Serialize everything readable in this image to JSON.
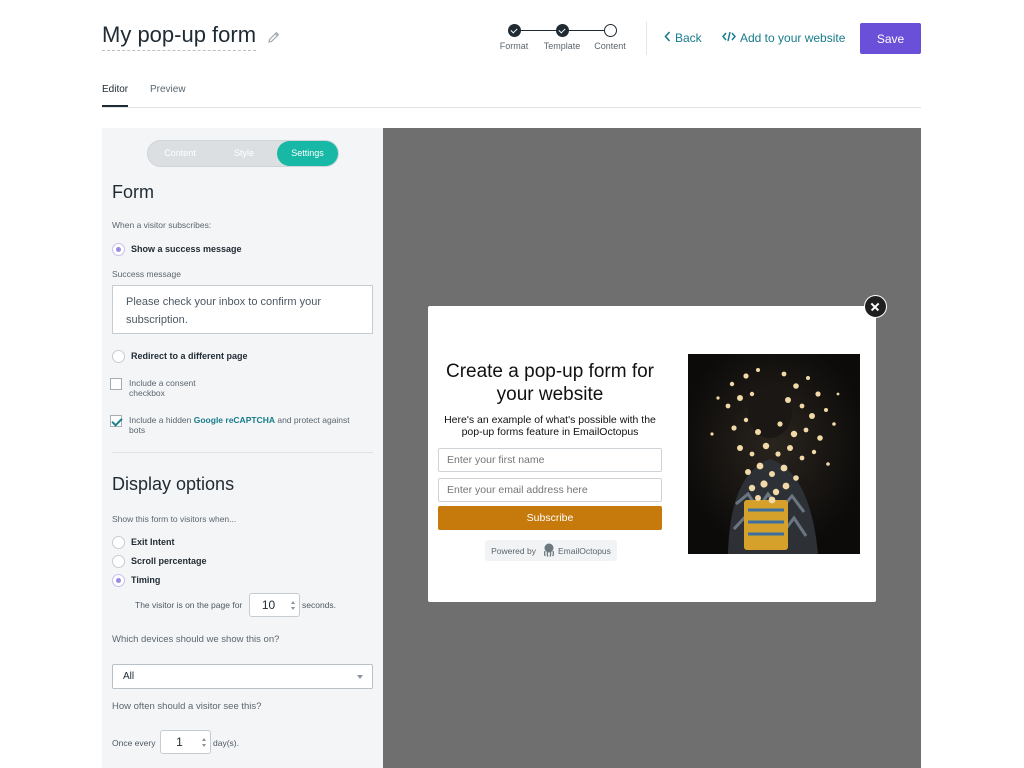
{
  "header": {
    "title": "My pop-up form",
    "steps": [
      {
        "label": "Format",
        "state": "done"
      },
      {
        "label": "Template",
        "state": "done"
      },
      {
        "label": "Content",
        "state": "current"
      }
    ],
    "back_label": "Back",
    "embed_label": "Add to your website",
    "save_label": "Save",
    "accent_color": "#6a50d8",
    "link_color": "#177c8c"
  },
  "tabs": [
    {
      "label": "Editor",
      "active": true
    },
    {
      "label": "Preview",
      "active": false
    }
  ],
  "sidebar": {
    "segments": [
      {
        "label": "Content",
        "active": false
      },
      {
        "label": "Style",
        "active": false
      },
      {
        "label": "Settings",
        "active": true
      }
    ],
    "form_heading": "Form",
    "subscribe_label": "When a visitor subscribes:",
    "show_success_label": "Show a success message",
    "success_message_label": "Success message",
    "success_message_value": "Please check your inbox to confirm your subscription.",
    "redirect_label": "Redirect to a different page",
    "consent_label": "Include a consent checkbox",
    "recaptcha_pre": "Include a hidden ",
    "recaptcha_link": "Google reCAPTCHA",
    "recaptcha_post": " and protect against bots",
    "display_heading": "Display options",
    "show_when_label": "Show this form to visitors when...",
    "exit_intent_label": "Exit Intent",
    "scroll_label": "Scroll percentage",
    "timing_label": "Timing",
    "timing_pre": "The visitor is on the page for",
    "timing_value": "10",
    "timing_post": "seconds.",
    "devices_label": "Which devices should we show this on?",
    "devices_value": "All",
    "frequency_label": "How often should a visitor see this?",
    "once_pre": "Once every",
    "once_value": "1",
    "once_post": "day(s)."
  },
  "popup": {
    "title": "Create a pop-up form for your website",
    "subtitle": "Here's an example of what's possible with the pop-up forms feature in EmailOctopus",
    "first_name_placeholder": "Enter your first name",
    "email_placeholder": "Enter your email address here",
    "subscribe_label": "Subscribe",
    "button_color": "#c77a0c",
    "powered_by": "Powered by",
    "brand": "EmailOctopus"
  }
}
